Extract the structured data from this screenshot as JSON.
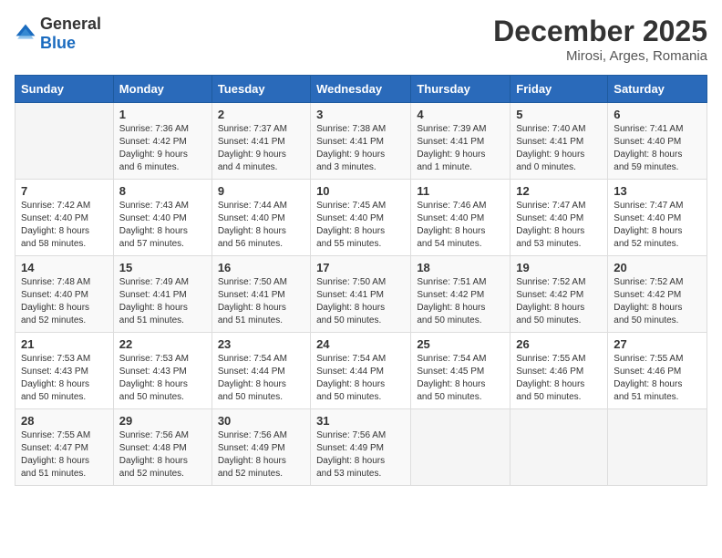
{
  "header": {
    "logo_general": "General",
    "logo_blue": "Blue",
    "month_title": "December 2025",
    "location": "Mirosi, Arges, Romania"
  },
  "weekdays": [
    "Sunday",
    "Monday",
    "Tuesday",
    "Wednesday",
    "Thursday",
    "Friday",
    "Saturday"
  ],
  "weeks": [
    [
      {
        "day": "",
        "info": ""
      },
      {
        "day": "1",
        "info": "Sunrise: 7:36 AM\nSunset: 4:42 PM\nDaylight: 9 hours\nand 6 minutes."
      },
      {
        "day": "2",
        "info": "Sunrise: 7:37 AM\nSunset: 4:41 PM\nDaylight: 9 hours\nand 4 minutes."
      },
      {
        "day": "3",
        "info": "Sunrise: 7:38 AM\nSunset: 4:41 PM\nDaylight: 9 hours\nand 3 minutes."
      },
      {
        "day": "4",
        "info": "Sunrise: 7:39 AM\nSunset: 4:41 PM\nDaylight: 9 hours\nand 1 minute."
      },
      {
        "day": "5",
        "info": "Sunrise: 7:40 AM\nSunset: 4:41 PM\nDaylight: 9 hours\nand 0 minutes."
      },
      {
        "day": "6",
        "info": "Sunrise: 7:41 AM\nSunset: 4:40 PM\nDaylight: 8 hours\nand 59 minutes."
      }
    ],
    [
      {
        "day": "7",
        "info": "Sunrise: 7:42 AM\nSunset: 4:40 PM\nDaylight: 8 hours\nand 58 minutes."
      },
      {
        "day": "8",
        "info": "Sunrise: 7:43 AM\nSunset: 4:40 PM\nDaylight: 8 hours\nand 57 minutes."
      },
      {
        "day": "9",
        "info": "Sunrise: 7:44 AM\nSunset: 4:40 PM\nDaylight: 8 hours\nand 56 minutes."
      },
      {
        "day": "10",
        "info": "Sunrise: 7:45 AM\nSunset: 4:40 PM\nDaylight: 8 hours\nand 55 minutes."
      },
      {
        "day": "11",
        "info": "Sunrise: 7:46 AM\nSunset: 4:40 PM\nDaylight: 8 hours\nand 54 minutes."
      },
      {
        "day": "12",
        "info": "Sunrise: 7:47 AM\nSunset: 4:40 PM\nDaylight: 8 hours\nand 53 minutes."
      },
      {
        "day": "13",
        "info": "Sunrise: 7:47 AM\nSunset: 4:40 PM\nDaylight: 8 hours\nand 52 minutes."
      }
    ],
    [
      {
        "day": "14",
        "info": "Sunrise: 7:48 AM\nSunset: 4:40 PM\nDaylight: 8 hours\nand 52 minutes."
      },
      {
        "day": "15",
        "info": "Sunrise: 7:49 AM\nSunset: 4:41 PM\nDaylight: 8 hours\nand 51 minutes."
      },
      {
        "day": "16",
        "info": "Sunrise: 7:50 AM\nSunset: 4:41 PM\nDaylight: 8 hours\nand 51 minutes."
      },
      {
        "day": "17",
        "info": "Sunrise: 7:50 AM\nSunset: 4:41 PM\nDaylight: 8 hours\nand 50 minutes."
      },
      {
        "day": "18",
        "info": "Sunrise: 7:51 AM\nSunset: 4:42 PM\nDaylight: 8 hours\nand 50 minutes."
      },
      {
        "day": "19",
        "info": "Sunrise: 7:52 AM\nSunset: 4:42 PM\nDaylight: 8 hours\nand 50 minutes."
      },
      {
        "day": "20",
        "info": "Sunrise: 7:52 AM\nSunset: 4:42 PM\nDaylight: 8 hours\nand 50 minutes."
      }
    ],
    [
      {
        "day": "21",
        "info": "Sunrise: 7:53 AM\nSunset: 4:43 PM\nDaylight: 8 hours\nand 50 minutes."
      },
      {
        "day": "22",
        "info": "Sunrise: 7:53 AM\nSunset: 4:43 PM\nDaylight: 8 hours\nand 50 minutes."
      },
      {
        "day": "23",
        "info": "Sunrise: 7:54 AM\nSunset: 4:44 PM\nDaylight: 8 hours\nand 50 minutes."
      },
      {
        "day": "24",
        "info": "Sunrise: 7:54 AM\nSunset: 4:44 PM\nDaylight: 8 hours\nand 50 minutes."
      },
      {
        "day": "25",
        "info": "Sunrise: 7:54 AM\nSunset: 4:45 PM\nDaylight: 8 hours\nand 50 minutes."
      },
      {
        "day": "26",
        "info": "Sunrise: 7:55 AM\nSunset: 4:46 PM\nDaylight: 8 hours\nand 50 minutes."
      },
      {
        "day": "27",
        "info": "Sunrise: 7:55 AM\nSunset: 4:46 PM\nDaylight: 8 hours\nand 51 minutes."
      }
    ],
    [
      {
        "day": "28",
        "info": "Sunrise: 7:55 AM\nSunset: 4:47 PM\nDaylight: 8 hours\nand 51 minutes."
      },
      {
        "day": "29",
        "info": "Sunrise: 7:56 AM\nSunset: 4:48 PM\nDaylight: 8 hours\nand 52 minutes."
      },
      {
        "day": "30",
        "info": "Sunrise: 7:56 AM\nSunset: 4:49 PM\nDaylight: 8 hours\nand 52 minutes."
      },
      {
        "day": "31",
        "info": "Sunrise: 7:56 AM\nSunset: 4:49 PM\nDaylight: 8 hours\nand 53 minutes."
      },
      {
        "day": "",
        "info": ""
      },
      {
        "day": "",
        "info": ""
      },
      {
        "day": "",
        "info": ""
      }
    ]
  ]
}
